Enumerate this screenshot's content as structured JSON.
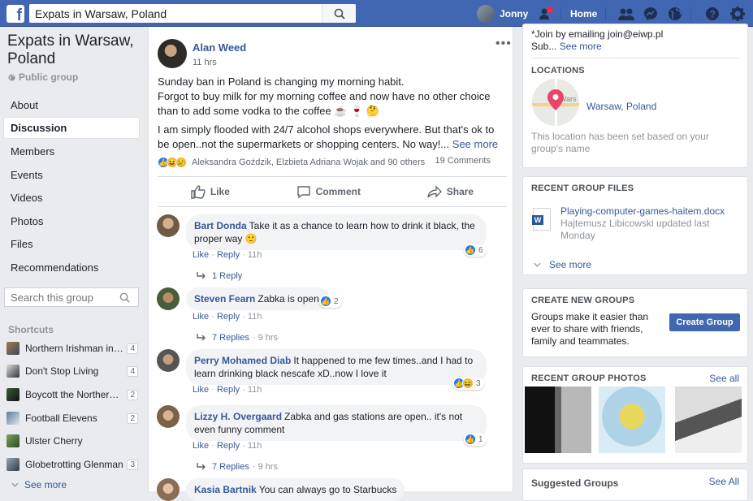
{
  "topbar": {
    "logo": "f",
    "search_value": "Expats in Warsaw, Poland",
    "user_name": "Jonny",
    "home_label": "Home"
  },
  "group": {
    "title": "Expats in Warsaw, Poland",
    "privacy": "Public group"
  },
  "nav": [
    {
      "label": "About"
    },
    {
      "label": "Discussion",
      "active": true
    },
    {
      "label": "Members"
    },
    {
      "label": "Events"
    },
    {
      "label": "Videos"
    },
    {
      "label": "Photos"
    },
    {
      "label": "Files"
    },
    {
      "label": "Recommendations"
    }
  ],
  "group_search": {
    "placeholder": "Search this group"
  },
  "shortcuts": {
    "header": "Shortcuts",
    "items": [
      {
        "name": "Northern Irishman in Warsaw",
        "count": "4"
      },
      {
        "name": "Don't Stop Living",
        "count": "4"
      },
      {
        "name": "Boycott the Northern Irishman",
        "count": "2"
      },
      {
        "name": "Football Elevens",
        "count": "2"
      },
      {
        "name": "Ulster Cherry",
        "count": ""
      },
      {
        "name": "Globetrotting Glenman",
        "count": "3"
      }
    ],
    "see_more": "See more"
  },
  "post": {
    "author": "Alan Weed",
    "time": "11 hrs",
    "line1": "Sunday ban in Poland is changing my morning habit.",
    "line2": "Forgot to buy milk for my morning coffee and now have no other choice than to add some vodka to the coffee ☕ 🍷 🤔",
    "line3": "I am simply flooded with 24/7 alcohol shops everywhere. But that's ok to be open..not the supermarkets or shopping centers. No way!...",
    "see_more": "See more",
    "reactors": "Aleksandra Goździk, Elzbieta Adriana Wojak and 90 others",
    "comments_count": "19 Comments",
    "actions": {
      "like": "Like",
      "comment": "Comment",
      "share": "Share"
    }
  },
  "comments": [
    {
      "name": "Bart Donda",
      "text": "Take it as a chance to learn how to drink it black, the proper way 🙂",
      "reactions": "6",
      "like": "Like",
      "reply": "Reply",
      "time": "11h",
      "replies": "1 Reply",
      "replies_time": ""
    },
    {
      "name": "Steven Fearn",
      "text": "Zabka is open.",
      "reactions": "2",
      "like": "Like",
      "reply": "Reply",
      "time": "11h",
      "replies": "7 Replies",
      "replies_time": "9 hrs"
    },
    {
      "name": "Perry Mohamed Diab",
      "text": "It happened to me few times..and I had to learn drinking black nescafe xD..now I love it",
      "reactions": "3",
      "like": "Like",
      "reply": "Reply",
      "time": "11h",
      "replies": "",
      "replies_time": ""
    },
    {
      "name": "Lizzy H. Overgaard",
      "text": "Zabka and gas stations are open.. it's not even funny comment",
      "reactions": "1",
      "like": "Like",
      "reply": "Reply",
      "time": "11h",
      "replies": "7 Replies",
      "replies_time": "9 hrs"
    },
    {
      "name": "Kasia Bartnik",
      "text": "You can always go to Starbucks",
      "reactions": "",
      "like": "",
      "reply": "",
      "time": "",
      "replies": "",
      "replies_time": ""
    }
  ],
  "right": {
    "join_text": "*Join by emailing join@eiwp.pl",
    "sub_text": "Sub...",
    "see_more": "See more",
    "locations_header": "LOCATIONS",
    "location_name": "Warsaw, Poland",
    "location_map_text": "Wars",
    "location_note": "This location has been set based on your group's name",
    "files_header": "RECENT GROUP FILES",
    "file_name": "Playing-computer-games-haitem.docx",
    "file_meta": "Hajtemusz Libicowski updated last Monday",
    "files_see_more": "See more",
    "create_header": "CREATE NEW GROUPS",
    "create_text": "Groups make it easier than ever to share with friends, family and teammates.",
    "create_button": "Create Group",
    "photos_header": "RECENT GROUP PHOTOS",
    "photos_see_all": "See all",
    "suggested_header": "Suggested Groups",
    "suggested_see_all": "See All"
  },
  "colors": {
    "brand": "#4267b2",
    "link": "#365899"
  }
}
